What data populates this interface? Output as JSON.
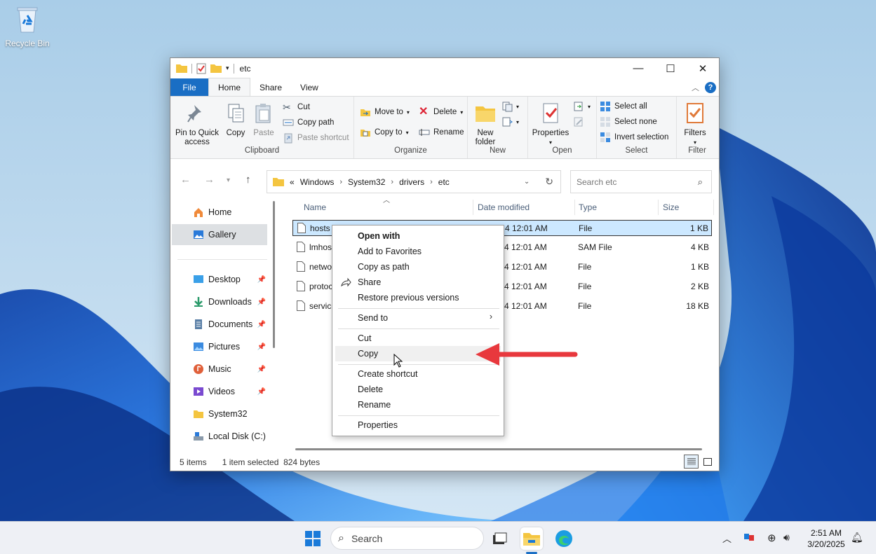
{
  "desktop": {
    "recycle_bin_label": "Recycle Bin"
  },
  "window": {
    "title": "etc",
    "controls": {
      "minimize": "—",
      "maximize": "☐",
      "close": "✕"
    }
  },
  "ribbon_tabs": [
    "File",
    "Home",
    "Share",
    "View"
  ],
  "ribbon": {
    "clipboard": {
      "label": "Clipboard",
      "pin": "Pin to Quick access",
      "copy": "Copy",
      "paste": "Paste",
      "cut": "Cut",
      "copy_path": "Copy path",
      "paste_shortcut": "Paste shortcut"
    },
    "organize": {
      "label": "Organize",
      "move_to": "Move to",
      "copy_to": "Copy to",
      "delete": "Delete",
      "rename": "Rename"
    },
    "new": {
      "label": "New",
      "new_folder": "New folder"
    },
    "open": {
      "label": "Open",
      "properties": "Properties"
    },
    "select": {
      "label": "Select",
      "select_all": "Select all",
      "select_none": "Select none",
      "invert": "Invert selection"
    },
    "filter": {
      "label": "Filter",
      "filters": "Filters"
    }
  },
  "address": {
    "prefix": "«",
    "crumbs": [
      "Windows",
      "System32",
      "drivers",
      "etc"
    ],
    "separator": "›"
  },
  "search": {
    "placeholder": "Search etc"
  },
  "nav_pane": {
    "items": [
      {
        "label": "Home"
      },
      {
        "label": "Gallery"
      },
      {
        "label": "Desktop"
      },
      {
        "label": "Downloads"
      },
      {
        "label": "Documents"
      },
      {
        "label": "Pictures"
      },
      {
        "label": "Music"
      },
      {
        "label": "Videos"
      },
      {
        "label": "System32"
      },
      {
        "label": "Local Disk (C:)"
      }
    ]
  },
  "columns": [
    "Name",
    "Date modified",
    "Type",
    "Size"
  ],
  "files": [
    {
      "name": "hosts",
      "date": "4 12:01 AM",
      "type": "File",
      "size": "1 KB"
    },
    {
      "name": "lmhos",
      "date": "4 12:01 AM",
      "type": "SAM File",
      "size": "4 KB"
    },
    {
      "name": "netwo",
      "date": "4 12:01 AM",
      "type": "File",
      "size": "1 KB"
    },
    {
      "name": "protoc",
      "date": "4 12:01 AM",
      "type": "File",
      "size": "2 KB"
    },
    {
      "name": "service",
      "date": "4 12:01 AM",
      "type": "File",
      "size": "18 KB"
    }
  ],
  "status": {
    "count": "5 items",
    "selection": "1 item selected  824 bytes"
  },
  "context_menu": {
    "open_with": "Open with",
    "add_favorites": "Add to Favorites",
    "copy_as_path": "Copy as path",
    "share": "Share",
    "restore": "Restore previous versions",
    "send_to": "Send to",
    "cut": "Cut",
    "copy": "Copy",
    "create_shortcut": "Create shortcut",
    "delete": "Delete",
    "rename": "Rename",
    "properties": "Properties"
  },
  "taskbar": {
    "search_placeholder": "Search",
    "clock_time": "2:51 AM",
    "clock_date": "3/20/2025"
  },
  "colors": {
    "accent": "#1a6ec4",
    "selection": "#cce8ff",
    "arrow": "#e8383d"
  },
  "icons": [
    "recycle-bin-icon",
    "folder-icon",
    "pin-icon",
    "copy-icon",
    "paste-icon",
    "scissors-icon",
    "delete-icon",
    "rename-icon",
    "properties-icon",
    "select-all-icon",
    "filter-icon",
    "home-icon",
    "gallery-icon",
    "desktop-icon",
    "downloads-icon",
    "documents-icon",
    "pictures-icon",
    "music-icon",
    "videos-icon",
    "drive-icon",
    "file-icon",
    "share-icon",
    "windows-start-icon",
    "search-icon",
    "task-view-icon",
    "file-explorer-icon",
    "edge-icon",
    "wifi-icon",
    "volume-icon",
    "bell-icon"
  ]
}
